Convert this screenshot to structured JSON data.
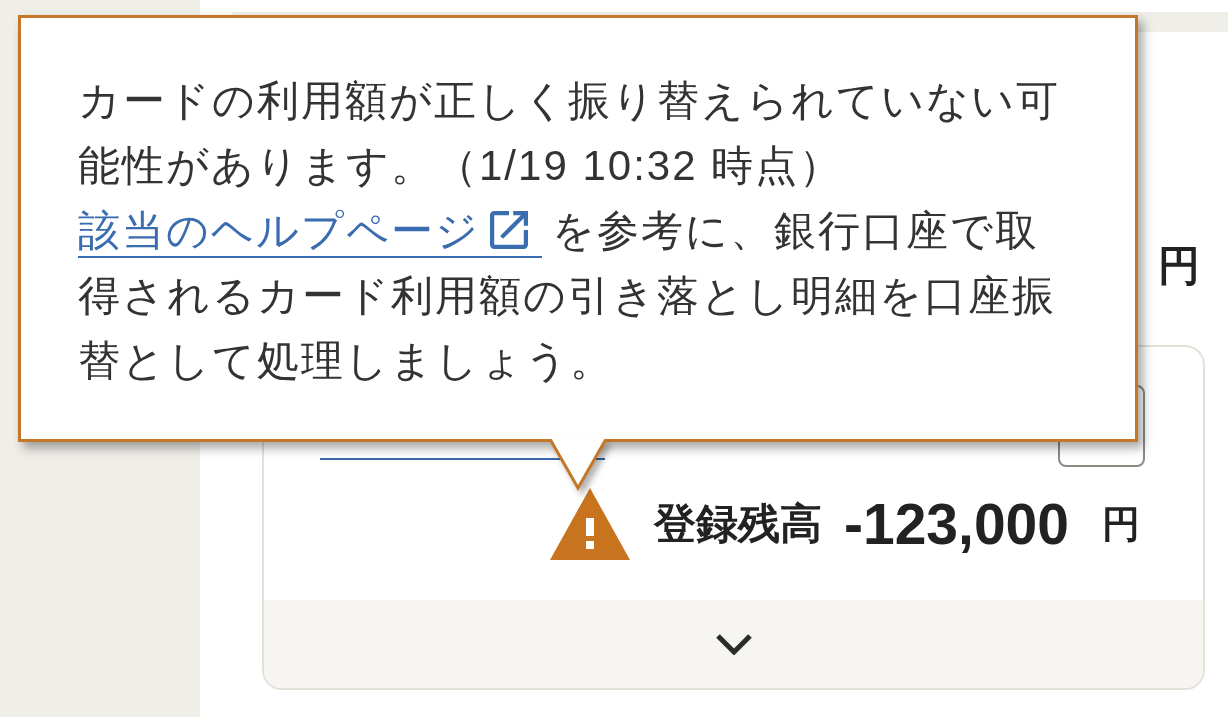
{
  "balance_summary": {
    "unit": "円"
  },
  "account_card": {
    "balance": {
      "label": "登録残高",
      "amount": "-123,000",
      "unit": "円",
      "warning": true
    },
    "expanded": false
  },
  "tooltip": {
    "message": "カードの利用額が正しく振り替えられていない可能性があります。（1/19 10:32 時点）",
    "help_link": "該当のヘルプページ",
    "help_text": "を参考に、銀行口座で取得されるカード利用額の引き落とし明細を口座振替として処理しましょう。"
  }
}
